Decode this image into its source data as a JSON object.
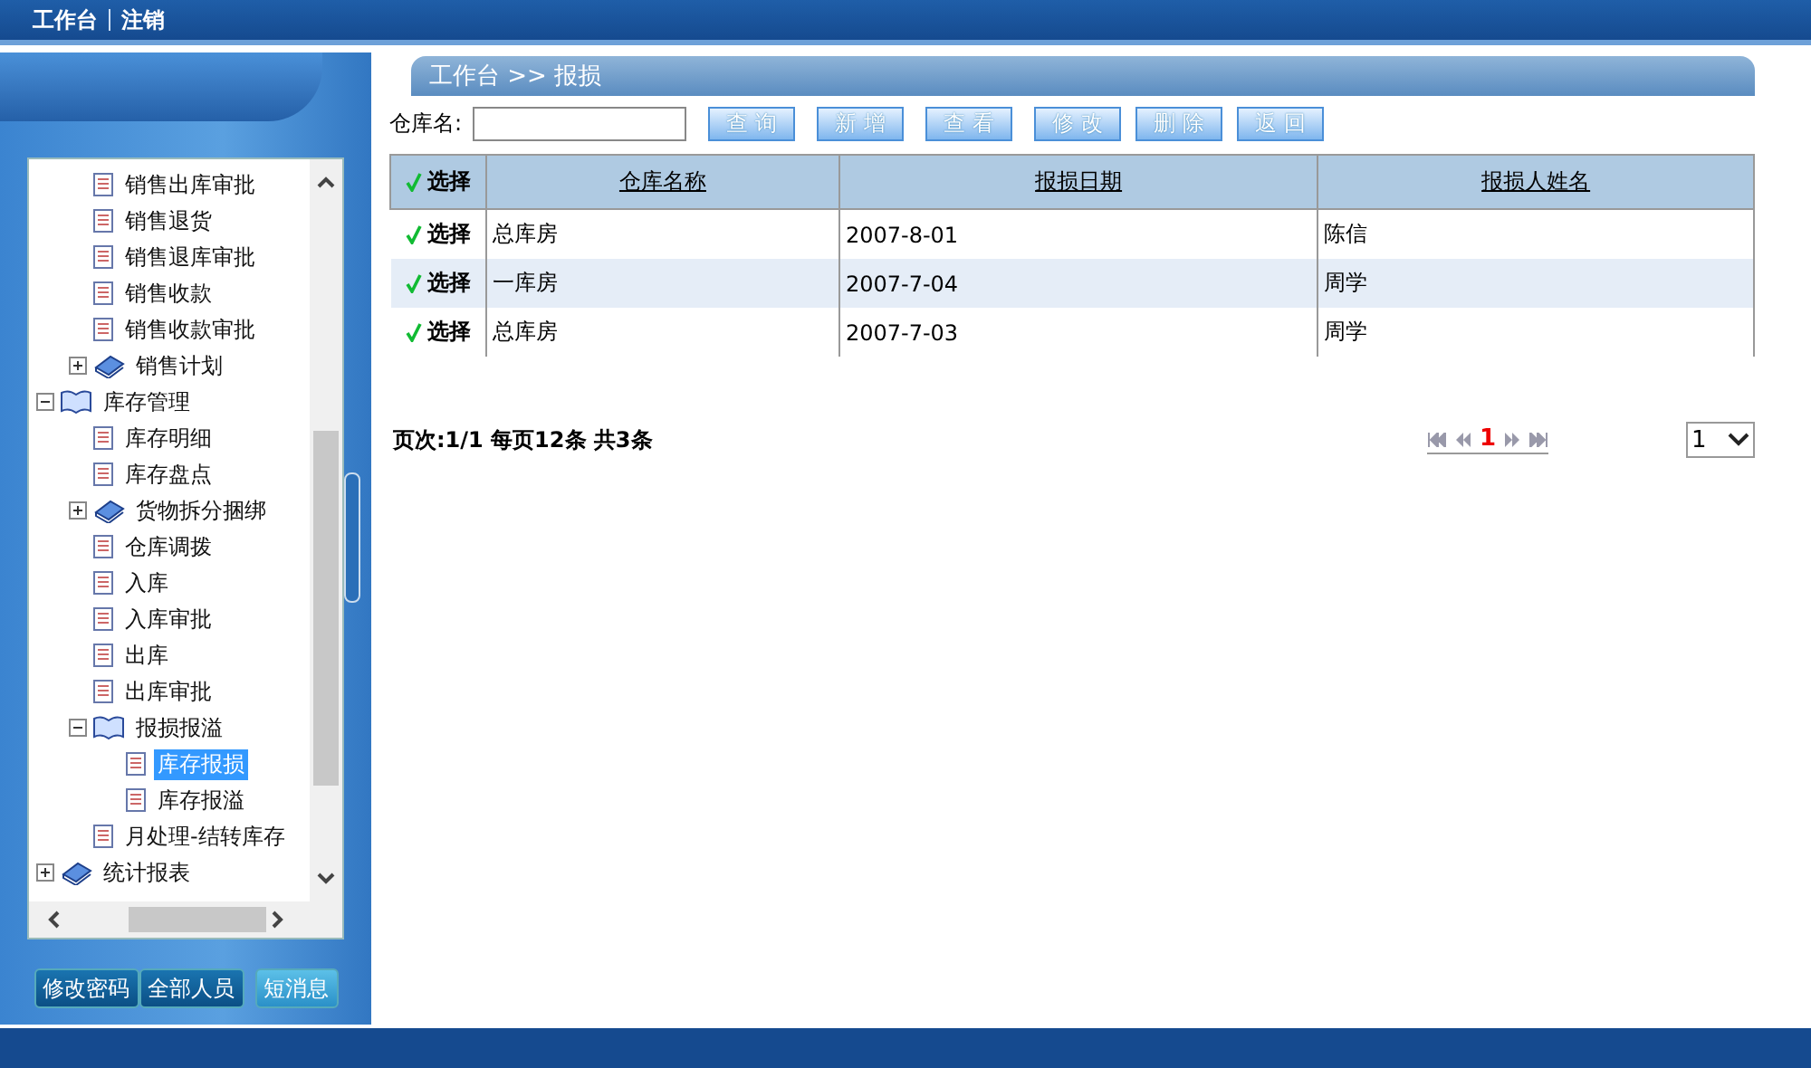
{
  "top_bar": {
    "links": [
      "工作台",
      "注销"
    ]
  },
  "tree": [
    {
      "children": [
        {
          "label": "销售出库审批",
          "kind": "page",
          "selected": false
        },
        {
          "label": "销售退货",
          "kind": "page",
          "selected": false
        },
        {
          "label": "销售退库审批",
          "kind": "page",
          "selected": false
        },
        {
          "label": "销售收款",
          "kind": "page",
          "selected": false
        },
        {
          "label": "销售收款审批",
          "kind": "page",
          "selected": false
        },
        {
          "label": "销售计划",
          "kind": "folder",
          "expanded": false,
          "selected": false
        }
      ]
    },
    {
      "label": "库存管理",
      "kind": "folder",
      "expanded": true,
      "selected": false,
      "children": [
        {
          "label": "库存明细",
          "kind": "page",
          "selected": false
        },
        {
          "label": "库存盘点",
          "kind": "page",
          "selected": false
        },
        {
          "label": "货物拆分捆绑",
          "kind": "folder",
          "expanded": false,
          "selected": false
        },
        {
          "label": "仓库调拨",
          "kind": "page",
          "selected": false
        },
        {
          "label": "入库",
          "kind": "page",
          "selected": false
        },
        {
          "label": "入库审批",
          "kind": "page",
          "selected": false
        },
        {
          "label": "出库",
          "kind": "page",
          "selected": false
        },
        {
          "label": "出库审批",
          "kind": "page",
          "selected": false
        },
        {
          "label": "报损报溢",
          "kind": "folder",
          "expanded": true,
          "selected": false,
          "children": [
            {
              "label": "库存报损",
              "kind": "page",
              "selected": true
            },
            {
              "label": "库存报溢",
              "kind": "page",
              "selected": false
            }
          ]
        },
        {
          "label": "月处理-结转库存",
          "kind": "page",
          "selected": false
        }
      ]
    },
    {
      "label": "统计报表",
      "kind": "folder",
      "expanded": false,
      "selected": false
    }
  ],
  "sidebar_buttons": [
    "修改密码",
    "全部人员",
    "短消息"
  ],
  "breadcrumb": "工作台 >> 报损",
  "search": {
    "label": "仓库名:"
  },
  "toolbar": [
    "查 询",
    "新 增",
    "查 看",
    "修 改",
    "删 除",
    "返 回"
  ],
  "table": {
    "columns": [
      "选择",
      "仓库名称",
      "报损日期",
      "报损人姓名"
    ],
    "rows": [
      {
        "cells": [
          "选择",
          "总库房",
          "2007-8-01",
          "陈信"
        ]
      },
      {
        "cells": [
          "选择",
          "一库房",
          "2007-7-04",
          "周学"
        ]
      },
      {
        "cells": [
          "选择",
          "总库房",
          "2007-7-03",
          "周学"
        ]
      }
    ]
  },
  "pager": {
    "summary": "页次:1/1 每页12条 共3条",
    "current": "1",
    "page_select": "1"
  }
}
